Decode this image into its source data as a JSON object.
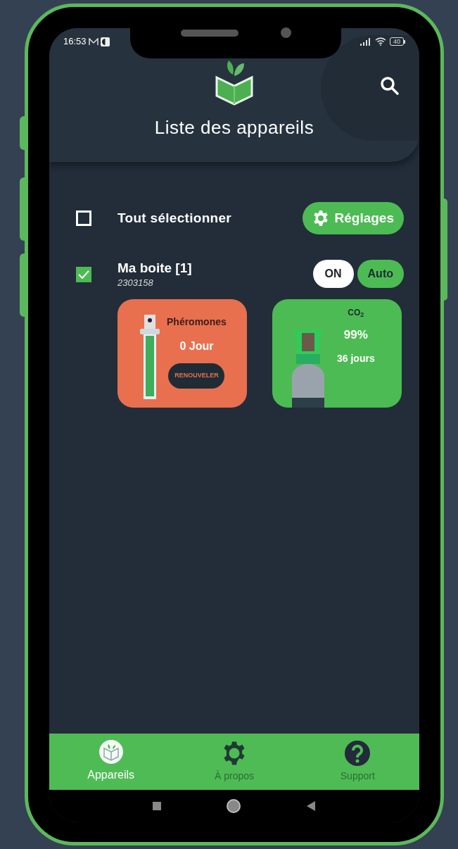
{
  "status_bar": {
    "time": "16:53",
    "battery": "40"
  },
  "header": {
    "title": "Liste des appareils"
  },
  "select_all": {
    "label": "Tout sélectionner",
    "checked": false
  },
  "settings_button": {
    "label": "Réglages"
  },
  "devices": [
    {
      "name": "Ma boite [1]",
      "serial": "2303158",
      "checked": true,
      "power": {
        "label": "ON",
        "on": true
      },
      "mode": "Auto",
      "cards": [
        {
          "kind": "pheromone",
          "title": "Phéromones",
          "value": "0 Jour",
          "button": "RENOUVELER"
        },
        {
          "kind": "co2",
          "title": "CO$_{2}$",
          "value": "99%",
          "detail": "36 jours"
        }
      ]
    }
  ],
  "nav": [
    {
      "kind": "devices",
      "label": "Appareils",
      "selected": true
    },
    {
      "kind": "about",
      "label": "À propos",
      "selected": false
    },
    {
      "kind": "support",
      "label": "Support",
      "selected": false
    }
  ]
}
